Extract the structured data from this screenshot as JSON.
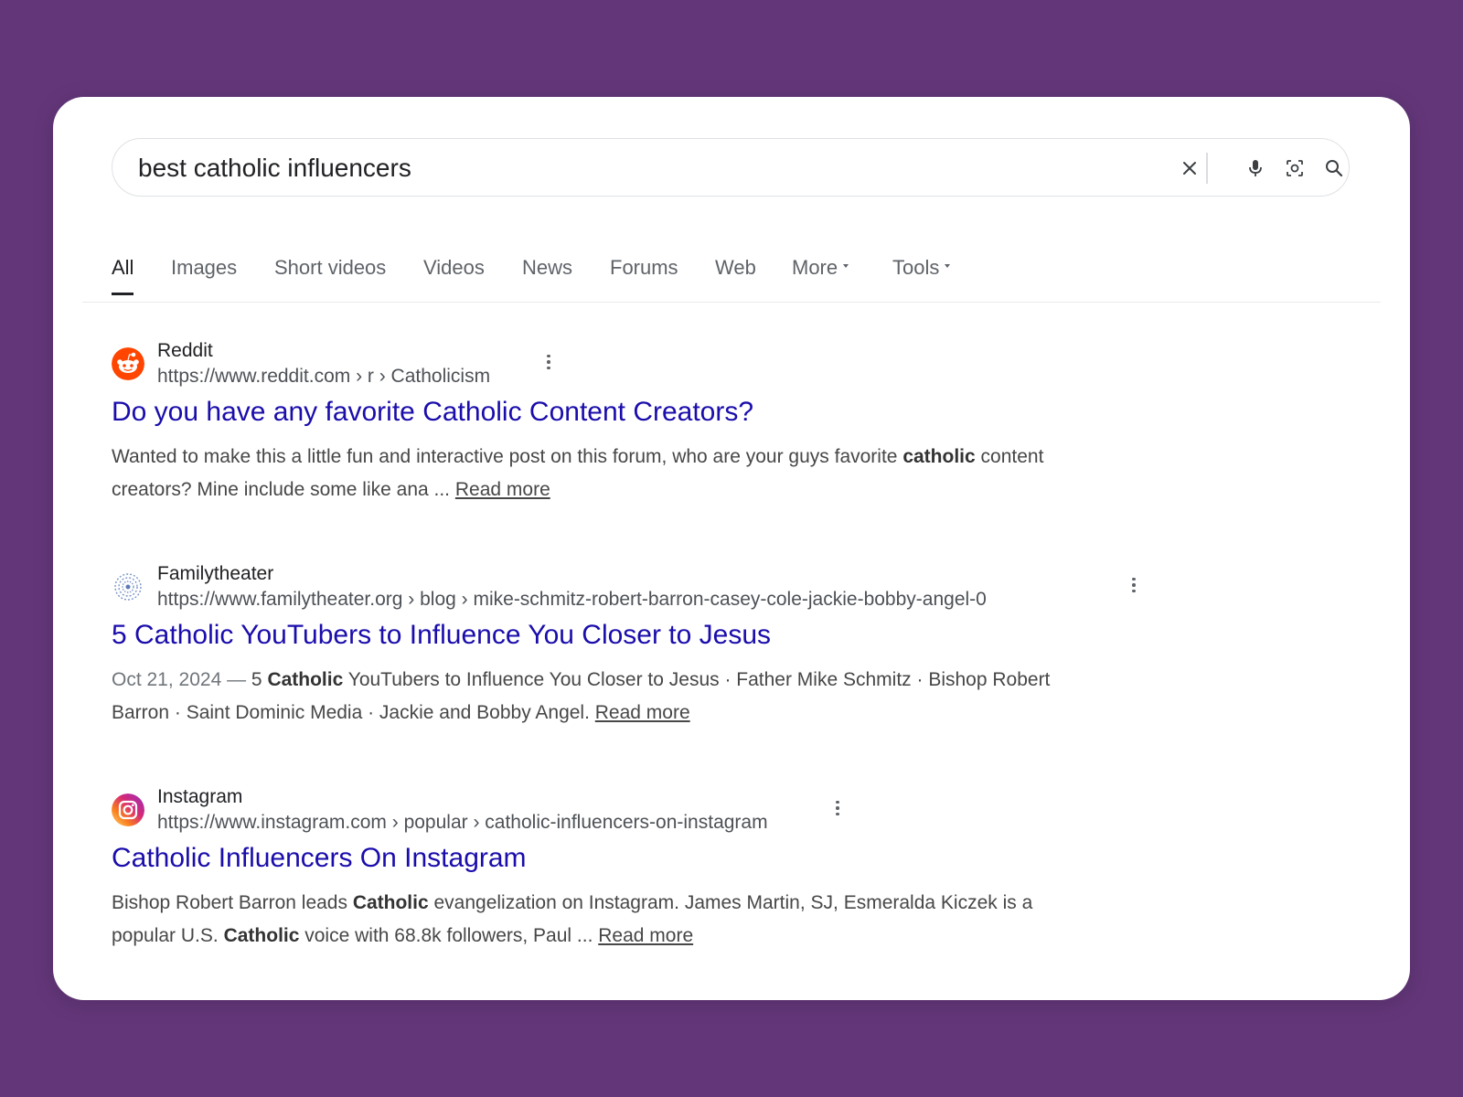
{
  "search": {
    "query": "best catholic influencers",
    "icons": [
      "close-icon",
      "microphone-icon",
      "lens-icon",
      "search-icon"
    ]
  },
  "tabs": [
    {
      "label": "All",
      "active": true
    },
    {
      "label": "Images"
    },
    {
      "label": "Short videos"
    },
    {
      "label": "Videos"
    },
    {
      "label": "News"
    },
    {
      "label": "Forums"
    },
    {
      "label": "Web"
    },
    {
      "label": "More",
      "dropdown": true
    },
    {
      "label": "Tools",
      "dropdown": true
    }
  ],
  "results": [
    {
      "site": "Reddit",
      "url": "https://www.reddit.com › r › Catholicism",
      "title": "Do you have any favorite Catholic Content Creators?",
      "snippet": {
        "part1": "Wanted to make this a little fun and interactive post on this forum, who are your guys favorite ",
        "bold1": "catholic",
        "part2": " content creators? Mine include some like ana ... ",
        "read_more": "Read more"
      }
    },
    {
      "site": "Familytheater",
      "url": "https://www.familytheater.org › blog › mike-schmitz-robert-barron-casey-cole-jackie-bobby-angel-0",
      "title": "5 Catholic YouTubers to Influence You Closer to Jesus",
      "snippet": {
        "date": "Oct 21, 2024 — ",
        "part1": "5 ",
        "bold1": "Catholic",
        "part2": " YouTubers to Influence You Closer to Jesus · Father Mike Schmitz · Bishop Robert Barron · Saint Dominic Media · Jackie and Bobby Angel. ",
        "read_more": "Read more"
      }
    },
    {
      "site": "Instagram",
      "url": "https://www.instagram.com › popular › catholic-influencers-on-instagram",
      "title": "Catholic Influencers On Instagram",
      "snippet": {
        "part1": "Bishop Robert Barron leads ",
        "bold1": "Catholic",
        "part2": " evangelization on Instagram. James Martin, SJ, Esmeralda Kiczek is a popular U.S. ",
        "bold2": "Catholic",
        "part3": " voice with 68.8k followers, Paul ... ",
        "read_more": "Read more"
      }
    }
  ],
  "colors": {
    "background": "#633679",
    "link": "#1a0dab",
    "reddit": "#ff4500"
  }
}
